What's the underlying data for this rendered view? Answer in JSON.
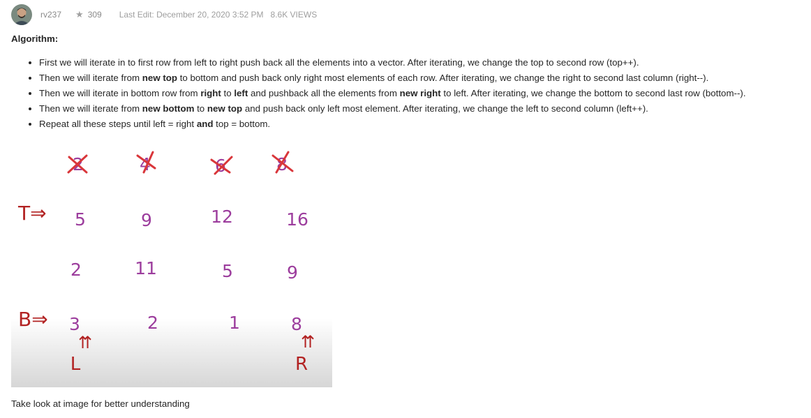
{
  "header": {
    "username": "rv237",
    "reputation": "309",
    "last_edit": "Last Edit: December 20, 2020 3:52 PM",
    "views": "8.6K VIEWS"
  },
  "post": {
    "title": "Algorithm:",
    "bullets": [
      {
        "segments": [
          {
            "text": "First we will iterate in to first row from left to right push back all the elements into a vector. After iterating, we change the top to second row (top++).",
            "bold": false
          }
        ]
      },
      {
        "segments": [
          {
            "text": "Then we will iterate from ",
            "bold": false
          },
          {
            "text": "new top",
            "bold": true
          },
          {
            "text": " to bottom and push back only right most elements of each row. After iterating, we change the right to second last column (right--).",
            "bold": false
          }
        ]
      },
      {
        "segments": [
          {
            "text": "Then we will iterate in bottom row from ",
            "bold": false
          },
          {
            "text": "right",
            "bold": true
          },
          {
            "text": " to ",
            "bold": false
          },
          {
            "text": "left",
            "bold": true
          },
          {
            "text": " and pushback all the elements from ",
            "bold": false
          },
          {
            "text": "new right",
            "bold": true
          },
          {
            "text": " to left. After iterating, we change the bottom to second last row (bottom--).",
            "bold": false
          }
        ]
      },
      {
        "segments": [
          {
            "text": "Then we will iterate from ",
            "bold": false
          },
          {
            "text": "new bottom",
            "bold": true
          },
          {
            "text": " to ",
            "bold": false
          },
          {
            "text": "new top",
            "bold": true
          },
          {
            "text": " and push back only left most element. After iterating, we change the left to second column (left++).",
            "bold": false
          }
        ]
      },
      {
        "segments": [
          {
            "text": "Repeat all these steps until left = right ",
            "bold": false
          },
          {
            "text": "and",
            "bold": true
          },
          {
            "text": " top = bottom.",
            "bold": false
          }
        ]
      }
    ],
    "caption": "Take look at image for better understanding"
  },
  "figure": {
    "crossed_row": [
      "2",
      "4",
      "6",
      "8"
    ],
    "rows": [
      [
        "5",
        "9",
        "12",
        "16"
      ],
      [
        "2",
        "11",
        "5",
        "9"
      ],
      [
        "3",
        "2",
        "1",
        "8"
      ]
    ],
    "top_marker": "T⇒",
    "bottom_marker": "B⇒",
    "left_label": "L",
    "right_label": "R",
    "arrow_glyph": "⇈"
  }
}
